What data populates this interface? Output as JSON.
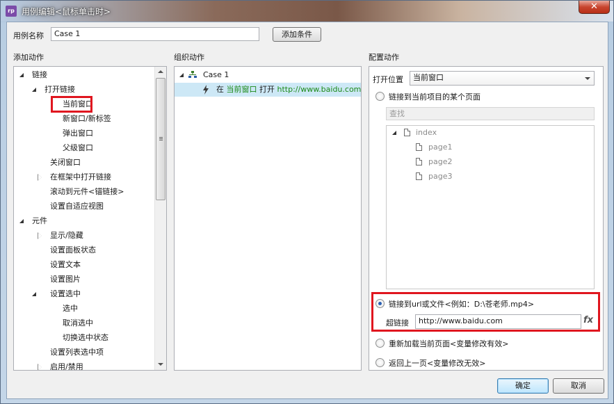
{
  "window": {
    "title": "用例编辑<鼠标单击时>",
    "app_icon_text": "rp",
    "close_glyph": "✕"
  },
  "case_name": {
    "label": "用例名称",
    "value": "Case 1",
    "add_condition_label": "添加条件"
  },
  "sections": {
    "add_action": "添加动作",
    "organize_action": "组织动作",
    "configure_action": "配置动作"
  },
  "action_tree": {
    "link": "链接",
    "open_link": "打开链接",
    "current_window": "当前窗口",
    "new_window": "新窗口/新标签",
    "popup_window": "弹出窗口",
    "parent_window": "父级窗口",
    "close_window": "关闭窗口",
    "open_in_frame": "在框架中打开链接",
    "scroll_to_widget": "滚动到元件<锚链接>",
    "set_adaptive_view": "设置自适应视图",
    "widget": "元件",
    "show_hide": "显示/隐藏",
    "set_panel_state": "设置面板状态",
    "set_text": "设置文本",
    "set_image": "设置图片",
    "set_selected": "设置选中",
    "selected": "选中",
    "unselect": "取消选中",
    "toggle_selected": "切换选中状态",
    "set_list_selected": "设置列表选中项",
    "enable_disable": "启用/禁用"
  },
  "organize": {
    "case_label": "Case 1",
    "action_prefix": "在",
    "action_target": "当前窗口",
    "action_verb": "打开",
    "action_url": "http://www.baidu.com"
  },
  "configure": {
    "open_in_label": "打开位置",
    "open_in_value": "当前窗口",
    "link_to_page_label": "链接到当前项目的某个页面",
    "search_placeholder": "查找",
    "pages": {
      "root": "index",
      "children": [
        "page1",
        "page2",
        "page3"
      ]
    },
    "link_to_url_label": "链接到url或文件<例如：D:\\苍老师.mp4>",
    "hyperlink_label": "超链接",
    "hyperlink_value": "http://www.baidu.com",
    "fx_label": "fx",
    "reload_label": "重新加载当前页面<变量修改有效>",
    "back_label": "返回上一页<变量修改无效>"
  },
  "footer": {
    "ok_label": "确定",
    "cancel_label": "取消"
  },
  "colors": {
    "highlight_red": "#e0161f",
    "link_green": "#1c8a18",
    "selection_blue": "#cde8f6",
    "lightning": "#3a3a3a"
  }
}
